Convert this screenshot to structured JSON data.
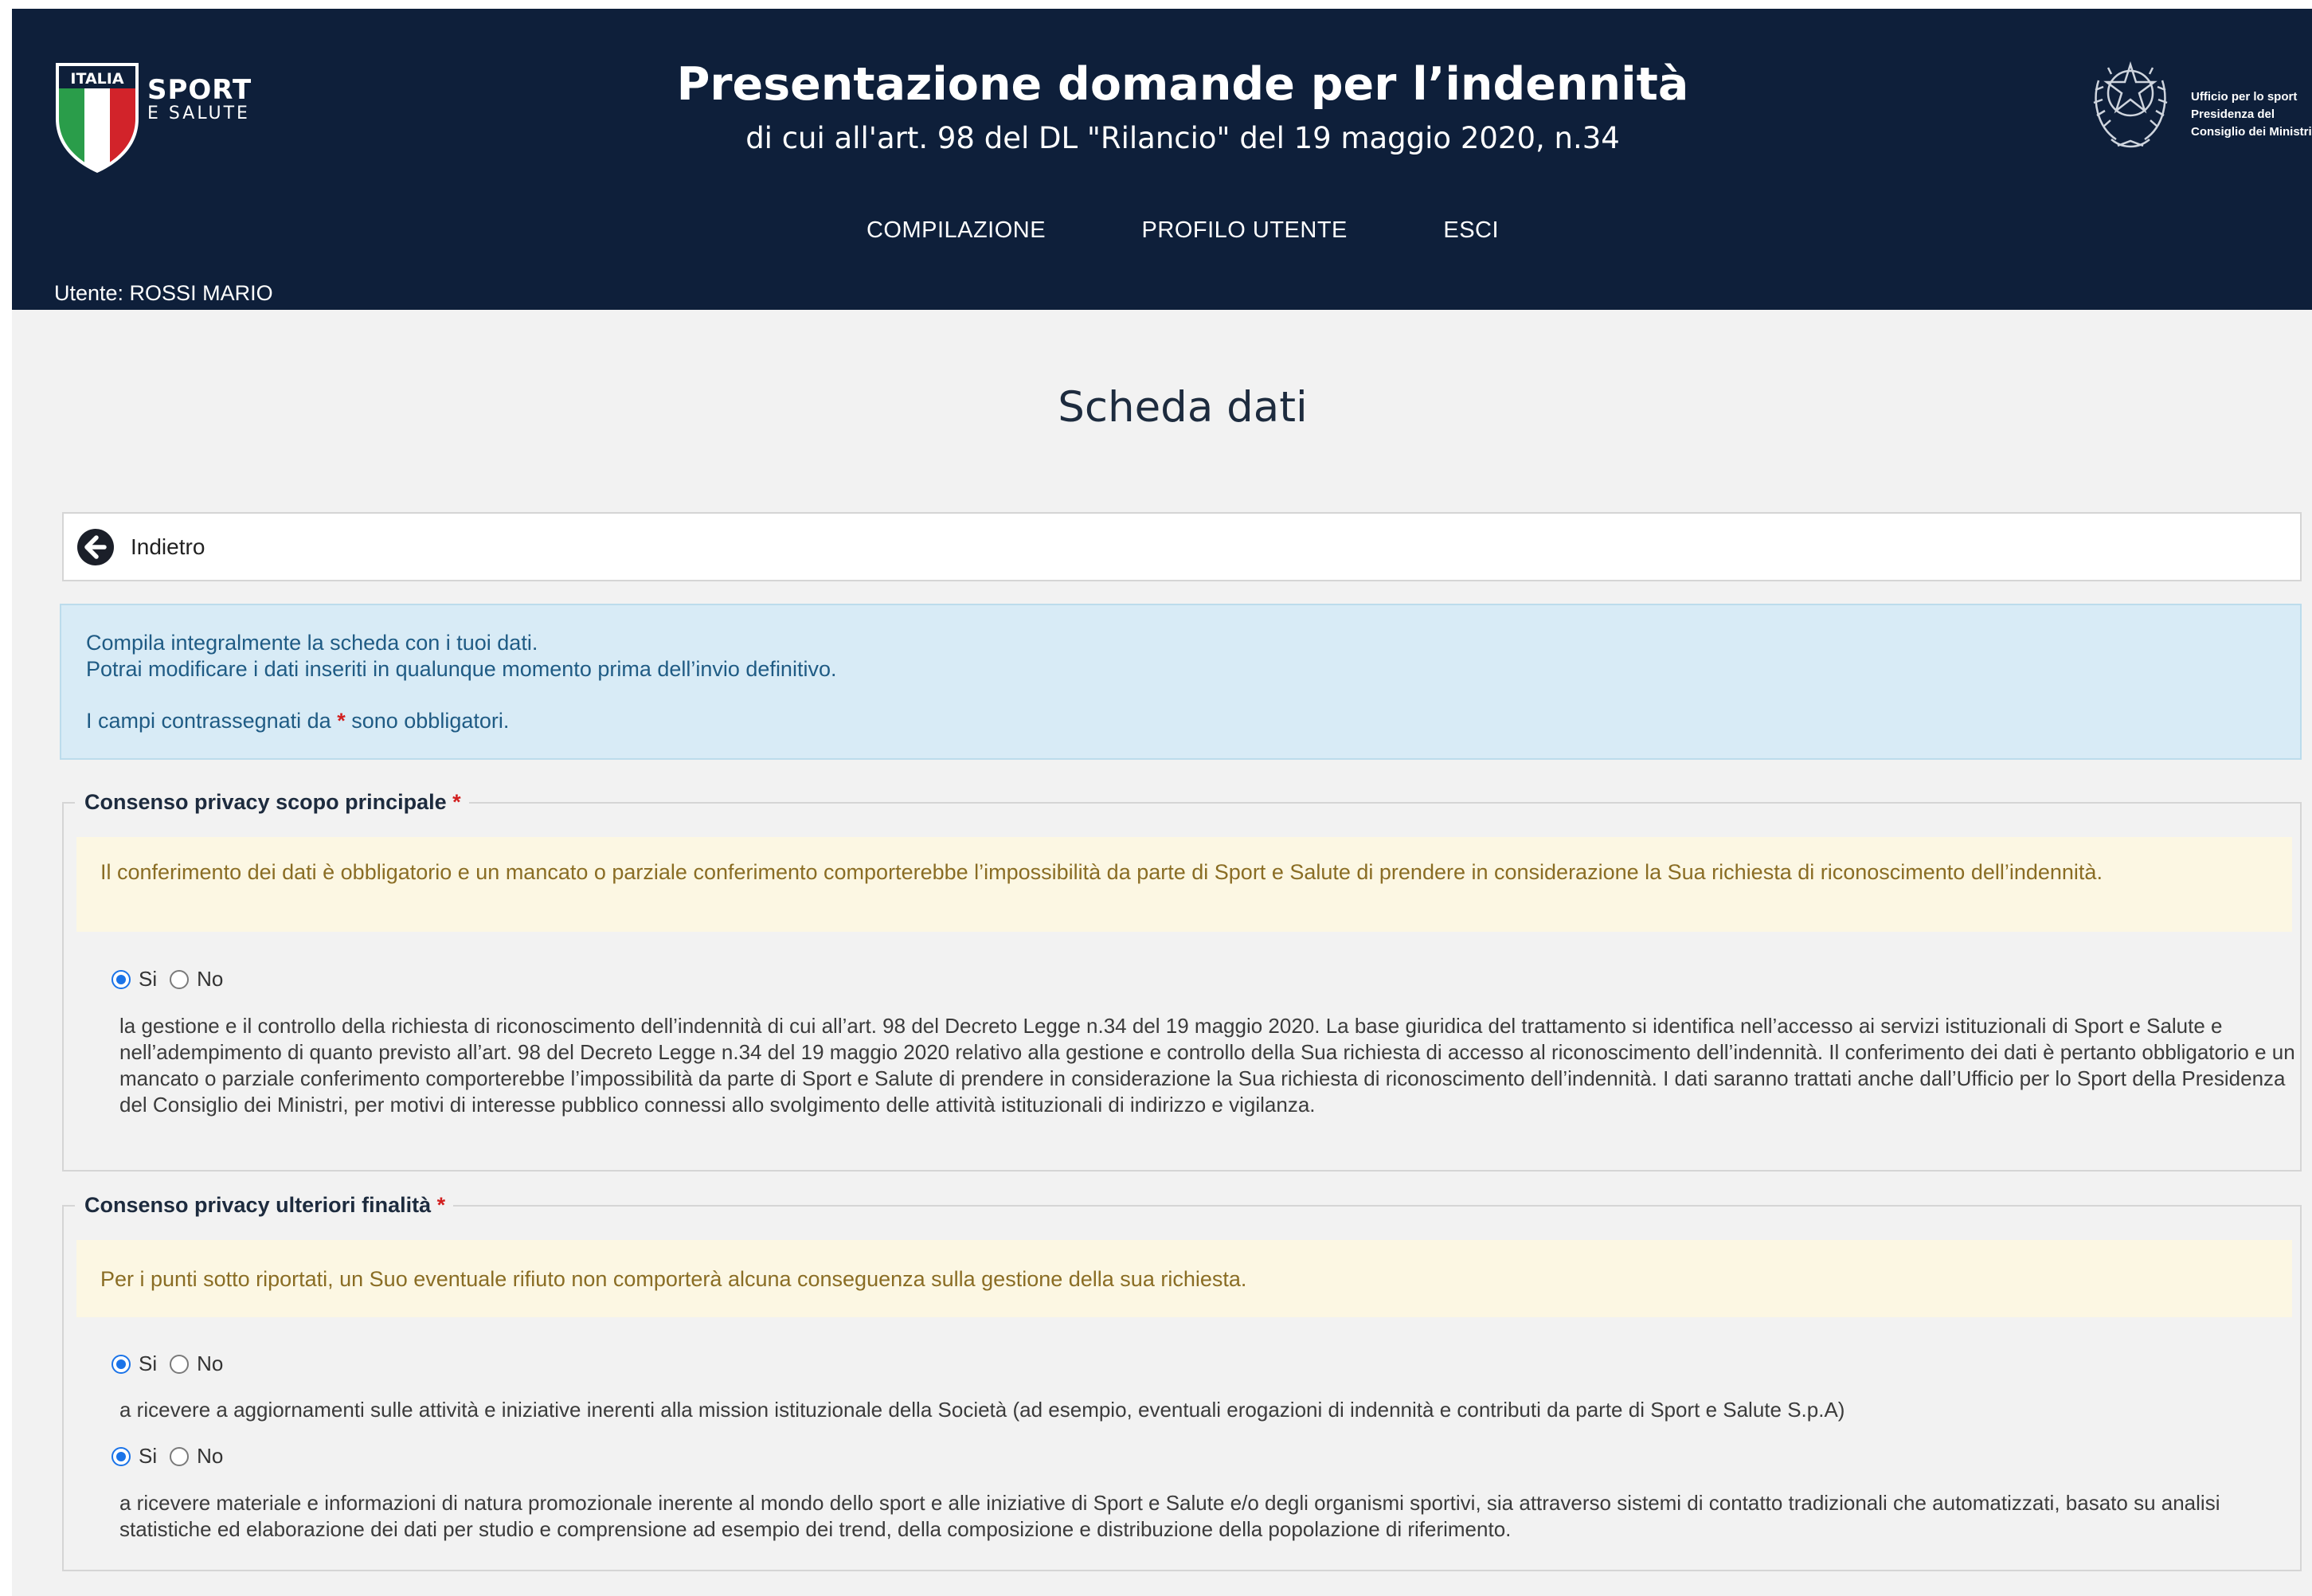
{
  "header": {
    "logo": {
      "line1": "ITALIA",
      "line2": "SPORT",
      "line3": "E SALUTE"
    },
    "title": "Presentazione domande per l’indennità",
    "subtitle": "di cui all'art. 98 del DL \"Rilancio\" del 19 maggio 2020, n.34",
    "gov": {
      "line1": "Ufficio per lo sport",
      "line2": "Presidenza del",
      "line3": "Consiglio dei Ministri"
    },
    "nav": [
      "COMPILAZIONE",
      "PROFILO UTENTE",
      "ESCI"
    ],
    "user": "Utente: ROSSI MARIO"
  },
  "page": {
    "title": "Scheda dati",
    "back_label": "Indietro"
  },
  "info": {
    "line1": "Compila integralmente la scheda con i tuoi dati.",
    "line2": "Potrai modificare i dati inseriti in qualunque momento prima dell’invio definitivo.",
    "line3_before": "I campi contrassegnati da",
    "required_mark": "*",
    "line3_after": "sono obbligatori."
  },
  "section1": {
    "legend": "Consenso privacy scopo principale",
    "required_mark": "*",
    "warning": "Il conferimento dei dati è obbligatorio e un mancato o parziale conferimento comporterebbe l’impossibilità da parte di Sport e Salute di prendere in considerazione la Sua richiesta di riconoscimento dell’indennità.",
    "options": [
      "Si",
      "No"
    ],
    "selected": "Si",
    "description": "la gestione e il controllo della richiesta di riconoscimento dell’indennità di cui all’art. 98 del Decreto Legge n.34 del 19 maggio 2020. La base giuridica del trattamento si identifica nell’accesso ai servizi istituzionali di Sport e Salute e nell’adempimento di quanto previsto all’art. 98 del Decreto Legge n.34 del 19 maggio 2020 relativo alla gestione e controllo della Sua richiesta di accesso al riconoscimento dell’indennità. Il conferimento dei dati è pertanto obbligatorio e un mancato o parziale conferimento comporterebbe l’impossibilità da parte di Sport e Salute di prendere in considerazione la Sua richiesta di riconoscimento dell’indennità. I dati saranno trattati anche dall’Ufficio per lo Sport della Presidenza del Consiglio dei Ministri, per motivi di interesse pubblico connessi allo svolgimento delle attività istituzionali di indirizzo e vigilanza."
  },
  "section2": {
    "legend": "Consenso privacy ulteriori finalità",
    "required_mark": "*",
    "warning": "Per i punti sotto riportati, un Suo eventuale rifiuto non comporterà alcuna conseguenza sulla gestione della sua richiesta.",
    "items": [
      {
        "options": [
          "Si",
          "No"
        ],
        "selected": "Si",
        "description": "a ricevere a aggiornamenti sulle attività e iniziative inerenti alla mission istituzionale della Società (ad esempio, eventuali erogazioni di indennità e contributi da parte di Sport e Salute S.p.A)"
      },
      {
        "options": [
          "Si",
          "No"
        ],
        "selected": "Si",
        "description": "a ricevere materiale e informazioni di natura promozionale inerente al mondo dello sport e alle iniziative di Sport e Salute e/o degli organismi sportivi, sia attraverso sistemi di contatto tradizionali che automatizzati, basato su analisi statistiche ed elaborazione dei dati per studio e comprensione ad esempio dei trend, della composizione e distribuzione della popolazione di riferimento."
      }
    ]
  },
  "colors": {
    "header_bg": "#0e1f3a",
    "page_bg": "#f2f2f2",
    "info_bg": "#d8ebf6",
    "info_text": "#1f5b84",
    "warning_bg": "#fcf7e3",
    "warning_text": "#8a6d24",
    "required": "#d21f1f",
    "radio_accent": "#1a73e8"
  }
}
